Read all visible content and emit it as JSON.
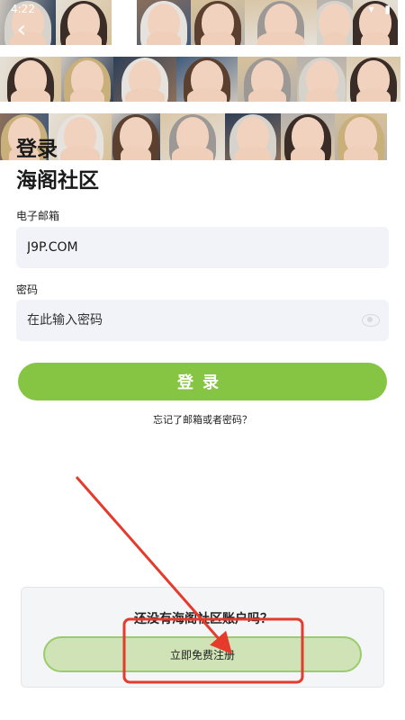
{
  "status_bar": {
    "time": "4:22",
    "icons": "▾ ▮"
  },
  "nav": {
    "back_icon": "chevron-left-icon",
    "back_glyph": "‹"
  },
  "colors": {
    "accent": "#86c443",
    "register_bg": "#cfe3b6",
    "annotation": "#e53a2c",
    "tile_backgrounds": [
      "#c9c3bb",
      "#e5e0d8",
      "#2e3f57",
      "#d7c19a",
      "#8a6e5a",
      "#b5b1ad",
      "#415a7a",
      "#d9c6a7"
    ]
  },
  "login": {
    "title": "登录",
    "community": "海阁社区",
    "email_label": "电子邮箱",
    "email_value": "J9P.COM",
    "password_label": "密码",
    "password_placeholder": "在此输入密码",
    "eye_icon": "eye-icon",
    "submit_label": "登录",
    "forgot_label": "忘记了邮箱或者密码？"
  },
  "register": {
    "prompt": "还没有海阁社区账户吗？",
    "button_label": "立即免费注册"
  }
}
